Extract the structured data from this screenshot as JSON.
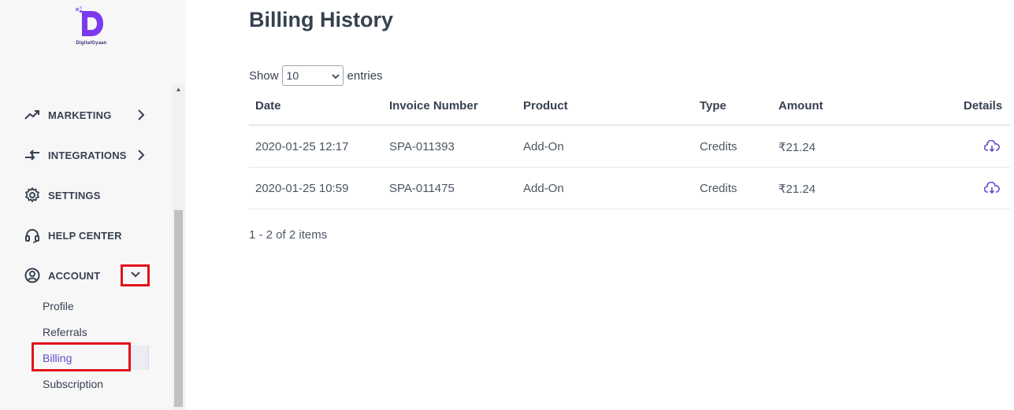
{
  "brand": {
    "logo_text": "DigitalGyaan"
  },
  "sidebar": {
    "items": [
      {
        "label": "MARKETING",
        "icon": "trending-up-icon",
        "chevron": "chevron-right-icon"
      },
      {
        "label": "INTEGRATIONS",
        "icon": "swap-arrows-icon",
        "chevron": "chevron-right-icon"
      },
      {
        "label": "SETTINGS",
        "icon": "gear-icon"
      },
      {
        "label": "HELP CENTER",
        "icon": "headset-icon"
      },
      {
        "label": "ACCOUNT",
        "icon": "user-circle-icon",
        "chevron": "chevron-down-icon"
      }
    ],
    "account_subitems": [
      "Profile",
      "Referrals",
      "Billing",
      "Subscription"
    ],
    "active_subitem": "Billing"
  },
  "main": {
    "title": "Billing History",
    "show_label": "Show",
    "entries_label": "entries",
    "page_size": "10",
    "columns": [
      "Date",
      "Invoice Number",
      "Product",
      "Type",
      "Amount",
      "Details"
    ],
    "rows": [
      {
        "date": "2020-01-25 12:17",
        "invoice": "SPA-011393",
        "product": "Add-On",
        "type": "Credits",
        "amount": "₹21.24",
        "details_icon": "cloud-download-icon"
      },
      {
        "date": "2020-01-25 10:59",
        "invoice": "SPA-011475",
        "product": "Add-On",
        "type": "Credits",
        "amount": "₹21.24",
        "details_icon": "cloud-download-icon"
      }
    ],
    "pagination_summary": "1 - 2 of 2 items"
  },
  "colors": {
    "accent": "#6d28d9",
    "highlight_box": "#e3121b",
    "link_active": "#5b4fcf"
  }
}
